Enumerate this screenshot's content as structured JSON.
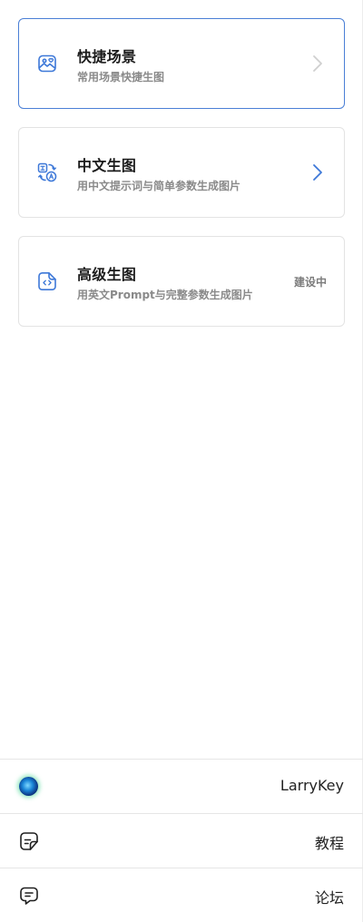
{
  "cards": [
    {
      "title": "快捷场景",
      "subtitle": "常用场景快捷生图",
      "icon": "image-icon",
      "chevron_color": "#cfcfcf"
    },
    {
      "title": "中文生图",
      "subtitle": "用中文提示词与简单参数生成图片",
      "icon": "translate-icon",
      "chevron_color": "#3d78d8"
    },
    {
      "title": "高级生图",
      "subtitle": "用英文Prompt与完整参数生成图片",
      "icon": "code-file-icon",
      "status": "建设中"
    }
  ],
  "footer": {
    "user": {
      "name": "LarryKey",
      "avatar": "avatar"
    },
    "tutorial": {
      "label": "教程",
      "icon": "note-icon"
    },
    "forum": {
      "label": "论坛",
      "icon": "chat-icon"
    }
  },
  "colors": {
    "accent": "#4a7fd6",
    "icon": "#3d78d8",
    "border": "#e3e3e3"
  }
}
